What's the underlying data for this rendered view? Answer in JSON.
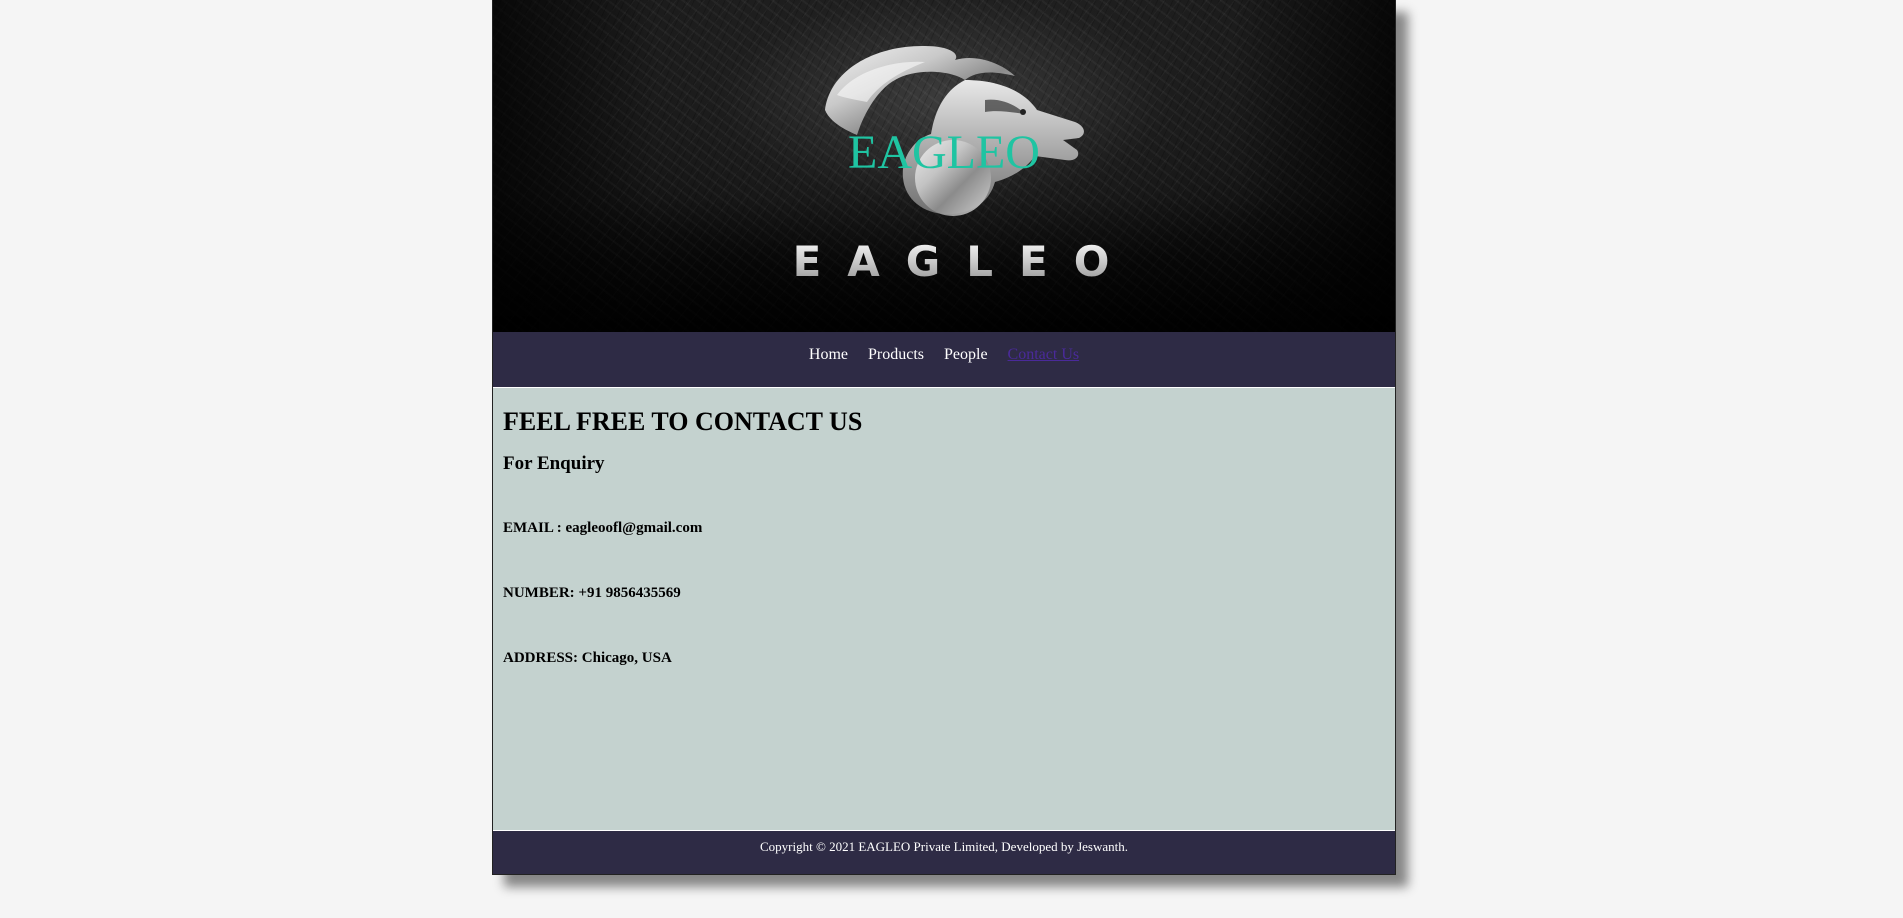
{
  "header": {
    "site_title": "EAGLEO",
    "logo_wordmark": "EAGLEO"
  },
  "nav": {
    "items": [
      {
        "label": "Home"
      },
      {
        "label": "Products"
      },
      {
        "label": "People"
      },
      {
        "label": "Contact Us",
        "active": true
      }
    ]
  },
  "main": {
    "heading": "FEEL FREE TO CONTACT US",
    "subheading": "For Enquiry",
    "email": "EMAIL : eagleoofl@gmail.com",
    "number": "NUMBER: +91 9856435569",
    "address": "ADDRESS: Chicago, USA"
  },
  "footer": {
    "copyright": "Copyright © 2021 EAGLEO Private Limited, Developed by Jeswanth."
  },
  "colors": {
    "page_background": "#f5f5f5",
    "nav_background": "#2e2b45",
    "content_background": "#c4d2cf",
    "title_accent": "#1fc4a2",
    "active_link": "#4a2a9a"
  },
  "icons": {
    "logo": "lion-head-logo"
  }
}
